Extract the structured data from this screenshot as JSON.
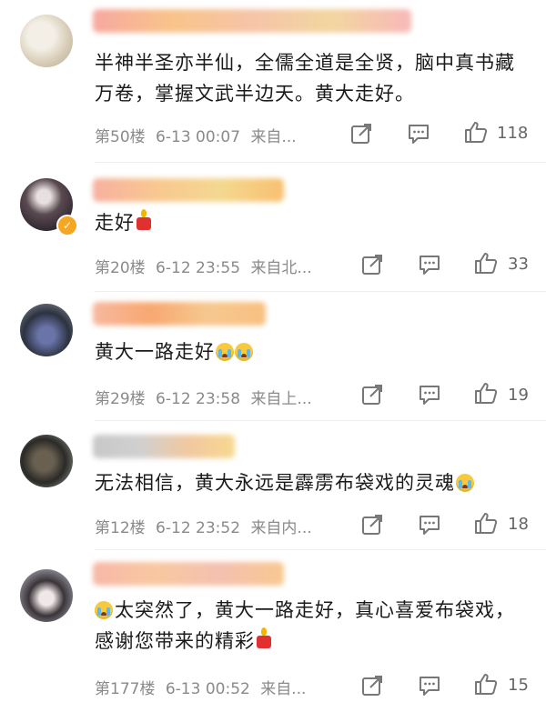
{
  "comments": [
    {
      "text_parts": [
        "半神半圣亦半仙，全儒全道是全贤，脑中真书藏万卷，掌握文武半边天。黄大走好。"
      ],
      "floor": "第50楼",
      "time": "6-13 00:07",
      "location": "来自...",
      "likes": "118",
      "verified": false
    },
    {
      "text_parts": [
        "走好"
      ],
      "floor": "第20楼",
      "time": "6-12 23:55",
      "location": "来自北...",
      "likes": "33",
      "verified": true
    },
    {
      "text_parts": [
        "黄大一路走好"
      ],
      "floor": "第29楼",
      "time": "6-12 23:58",
      "location": "来自上...",
      "likes": "19",
      "verified": false
    },
    {
      "text_parts": [
        "无法相信，黄大永远是霹雳布袋戏的灵魂"
      ],
      "floor": "第12楼",
      "time": "6-12 23:52",
      "location": "来自内...",
      "likes": "18",
      "verified": false
    },
    {
      "text_parts": [
        "太突然了，黄大一路走好，真心喜爱布袋戏，感谢您带来的精彩"
      ],
      "floor": "第177楼",
      "time": "6-13 00:52",
      "location": "来自...",
      "likes": "15",
      "verified": false
    }
  ],
  "icons": {
    "share": "share-icon",
    "comment": "comment-icon",
    "like": "thumbs-up-icon",
    "candle": "candle-emoji",
    "cry": "crying-face-emoji"
  },
  "colors": {
    "username_blur": "#f6b26b",
    "meta_text": "#8a8a8a",
    "verified_badge": "#f5a623"
  }
}
